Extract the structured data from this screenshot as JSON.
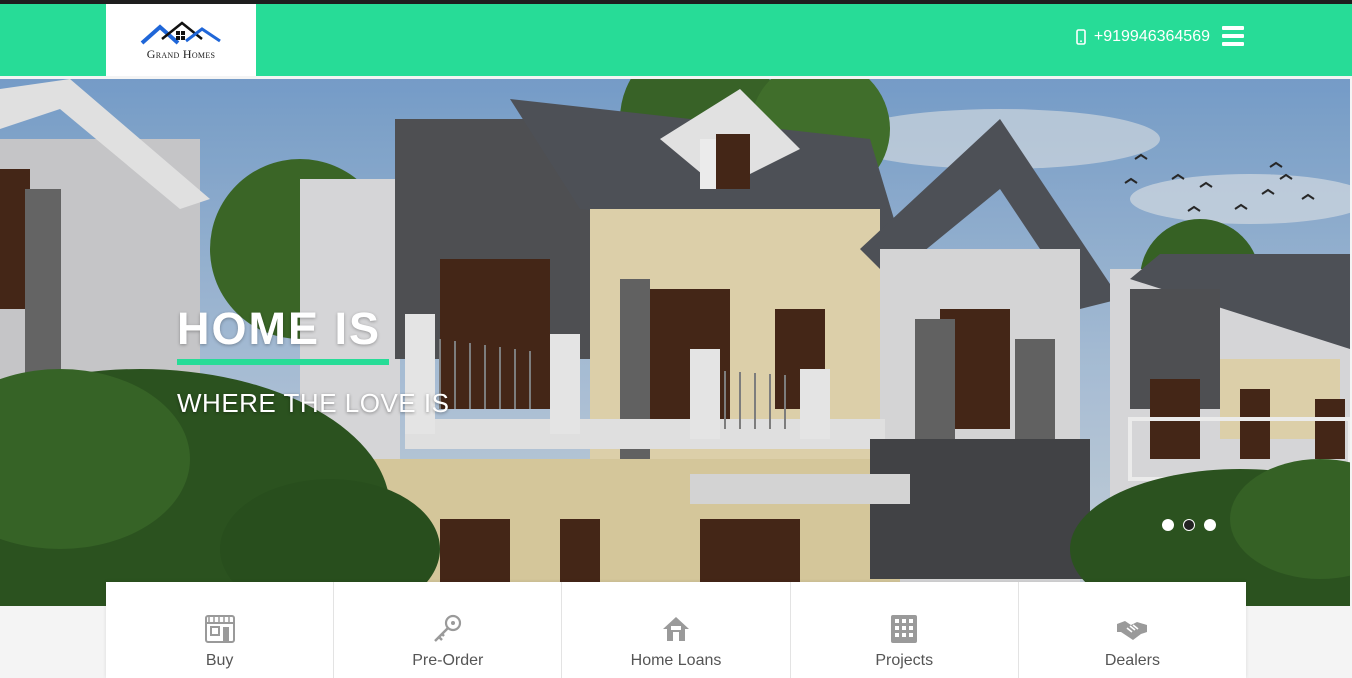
{
  "header": {
    "logo_text": "Grand Homes",
    "phone": "+919946364569",
    "accent_color": "#27dc97"
  },
  "hero": {
    "title": "HOME IS",
    "subtitle": "WHERE THE LOVE IS",
    "slides_count": 3,
    "active_slide": 2
  },
  "services": [
    {
      "label": "Buy",
      "icon": "store-icon"
    },
    {
      "label": "Pre-Order",
      "icon": "key-icon"
    },
    {
      "label": "Home Loans",
      "icon": "house-icon"
    },
    {
      "label": "Projects",
      "icon": "building-icon"
    },
    {
      "label": "Dealers",
      "icon": "handshake-icon"
    }
  ]
}
